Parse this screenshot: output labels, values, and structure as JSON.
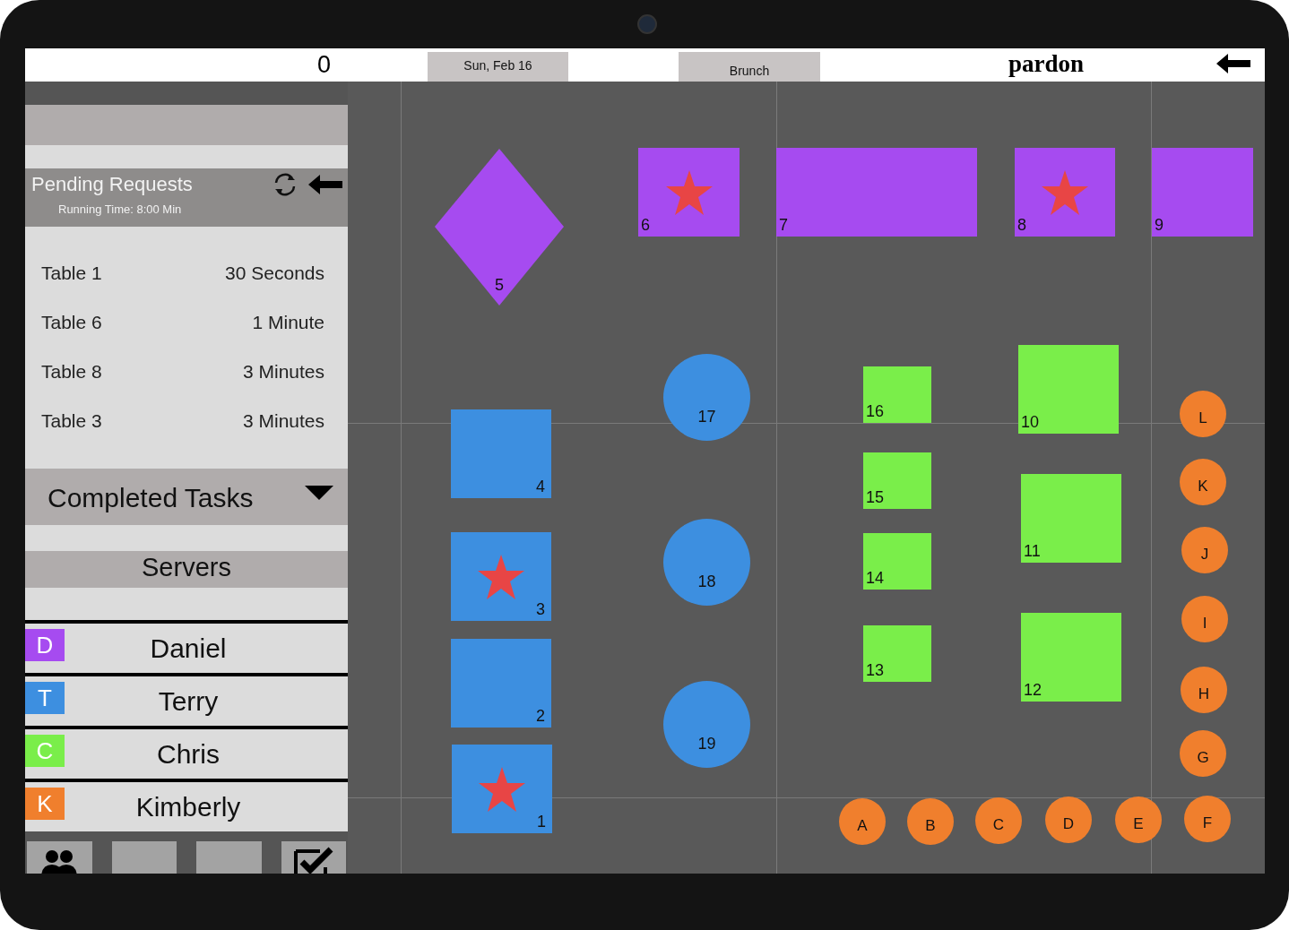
{
  "top_bar": {
    "count": "0",
    "date_button": "Sun, Feb 16",
    "service_button": "Brunch",
    "logo": "pardon"
  },
  "pending_requests": {
    "title": "Pending Requests",
    "running_time": "Running Time: 8:00 Min",
    "items": [
      {
        "table": "Table 1",
        "wait": "30 Seconds"
      },
      {
        "table": "Table 6",
        "wait": "1 Minute"
      },
      {
        "table": "Table 8",
        "wait": "3 Minutes"
      },
      {
        "table": "Table 3",
        "wait": "3 Minutes"
      }
    ]
  },
  "completed_tasks": {
    "title": "Completed Tasks"
  },
  "servers": {
    "title": "Servers",
    "items": [
      {
        "initial": "D",
        "name": "Daniel",
        "color": "#a64bf0"
      },
      {
        "initial": "T",
        "name": "Terry",
        "color": "#3d8fe0"
      },
      {
        "initial": "C",
        "name": "Chris",
        "color": "#7aee4a"
      },
      {
        "initial": "K",
        "name": "Kimberly",
        "color": "#f07f2d"
      }
    ]
  },
  "floor": {
    "tables": [
      {
        "label": "5",
        "kind": "diamond",
        "color": "#a64bf0",
        "starred": false
      },
      {
        "label": "6",
        "kind": "rect",
        "color": "#a64bf0",
        "starred": true
      },
      {
        "label": "7",
        "kind": "rect",
        "color": "#a64bf0",
        "starred": false
      },
      {
        "label": "8",
        "kind": "rect",
        "color": "#a64bf0",
        "starred": true
      },
      {
        "label": "9",
        "kind": "rect",
        "color": "#a64bf0",
        "starred": false
      },
      {
        "label": "4",
        "kind": "rect",
        "color": "#3d8fe0",
        "starred": false
      },
      {
        "label": "3",
        "kind": "rect",
        "color": "#3d8fe0",
        "starred": true
      },
      {
        "label": "2",
        "kind": "rect",
        "color": "#3d8fe0",
        "starred": false
      },
      {
        "label": "1",
        "kind": "rect",
        "color": "#3d8fe0",
        "starred": true
      },
      {
        "label": "17",
        "kind": "round",
        "color": "#3d8fe0",
        "starred": false
      },
      {
        "label": "18",
        "kind": "round",
        "color": "#3d8fe0",
        "starred": false
      },
      {
        "label": "19",
        "kind": "round",
        "color": "#3d8fe0",
        "starred": false
      },
      {
        "label": "16",
        "kind": "rect",
        "color": "#7aee4a",
        "starred": false
      },
      {
        "label": "15",
        "kind": "rect",
        "color": "#7aee4a",
        "starred": false
      },
      {
        "label": "14",
        "kind": "rect",
        "color": "#7aee4a",
        "starred": false
      },
      {
        "label": "13",
        "kind": "rect",
        "color": "#7aee4a",
        "starred": false
      },
      {
        "label": "10",
        "kind": "rect",
        "color": "#7aee4a",
        "starred": false
      },
      {
        "label": "11",
        "kind": "rect",
        "color": "#7aee4a",
        "starred": false
      },
      {
        "label": "12",
        "kind": "rect",
        "color": "#7aee4a",
        "starred": false
      }
    ],
    "seats": [
      {
        "label": "L",
        "color": "#f07f2d"
      },
      {
        "label": "K",
        "color": "#f07f2d"
      },
      {
        "label": "J",
        "color": "#f07f2d"
      },
      {
        "label": "I",
        "color": "#f07f2d"
      },
      {
        "label": "H",
        "color": "#f07f2d"
      },
      {
        "label": "G",
        "color": "#f07f2d"
      },
      {
        "label": "A",
        "color": "#f07f2d"
      },
      {
        "label": "B",
        "color": "#f07f2d"
      },
      {
        "label": "C",
        "color": "#f07f2d"
      },
      {
        "label": "D",
        "color": "#f07f2d"
      },
      {
        "label": "E",
        "color": "#f07f2d"
      },
      {
        "label": "F",
        "color": "#f07f2d"
      }
    ]
  }
}
